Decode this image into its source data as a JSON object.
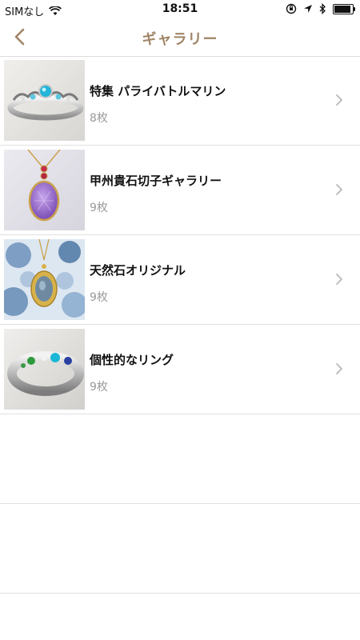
{
  "status": {
    "carrier": "SIMなし",
    "time": "18:51"
  },
  "nav": {
    "title": "ギャラリー",
    "accent": "#a08466"
  },
  "items": [
    {
      "title": "特集 パライバトルマリン",
      "count": "8枚",
      "icon": "ring-tiara-photo"
    },
    {
      "title": "甲州貴石切子ギャラリー",
      "count": "9枚",
      "icon": "amethyst-pendant-photo"
    },
    {
      "title": "天然石オリジナル",
      "count": "9枚",
      "icon": "oval-pendant-photo"
    },
    {
      "title": "個性的なリング",
      "count": "9枚",
      "icon": "gem-ring-photo"
    }
  ]
}
